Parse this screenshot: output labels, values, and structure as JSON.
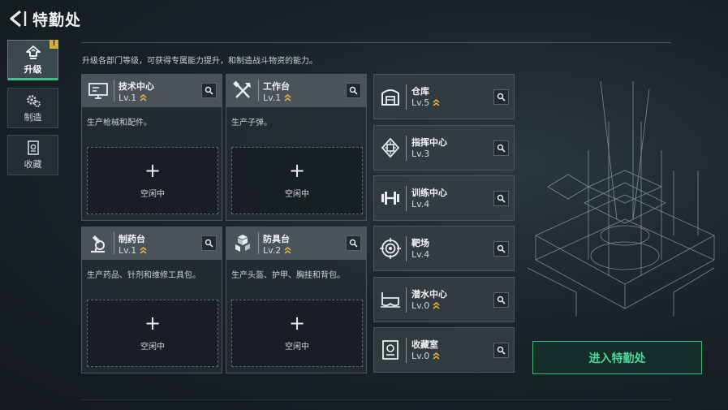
{
  "header": {
    "title": "特勤处"
  },
  "nav": [
    {
      "label": "升级",
      "icon": "upgrade-icon",
      "active": true,
      "badge": "!"
    },
    {
      "label": "制造",
      "icon": "gears-icon",
      "active": false
    },
    {
      "label": "收藏",
      "icon": "collection-icon",
      "active": false
    }
  ],
  "description": "升级各部门等级，可获得专属能力提升，和制造战斗物资的能力。",
  "cards": [
    {
      "name": "技术中心",
      "level": "Lv.1",
      "upgradable": true,
      "icon": "monitor-icon",
      "desc": "生产枪械和配件。",
      "slot_plus": "+",
      "slot_label": "空闲中"
    },
    {
      "name": "工作台",
      "level": "Lv.1",
      "upgradable": true,
      "icon": "tools-icon",
      "desc": "生产子弹。",
      "slot_plus": "+",
      "slot_label": "空闲中"
    },
    {
      "name": "制药台",
      "level": "Lv.1",
      "upgradable": true,
      "icon": "microscope-icon",
      "desc": "生产药品、针剂和维修工具包。",
      "slot_plus": "+",
      "slot_label": "空闲中"
    },
    {
      "name": "防具台",
      "level": "Lv.2",
      "upgradable": true,
      "icon": "armor-blocks-icon",
      "desc": "生产头盔、护甲、胸挂和背包。",
      "slot_plus": "+",
      "slot_label": "空闲中"
    }
  ],
  "facilities": [
    {
      "name": "仓库",
      "level": "Lv.5",
      "upgradable": true,
      "icon": "warehouse-icon"
    },
    {
      "name": "指挥中心",
      "level": "Lv.3",
      "upgradable": false,
      "icon": "chip-icon"
    },
    {
      "name": "训练中心",
      "level": "Lv.4",
      "upgradable": false,
      "icon": "dumbbell-icon"
    },
    {
      "name": "靶场",
      "level": "Lv.4",
      "upgradable": false,
      "icon": "target-icon"
    },
    {
      "name": "潜水中心",
      "level": "Lv.0",
      "upgradable": true,
      "icon": "diving-mask-icon"
    },
    {
      "name": "收藏室",
      "level": "Lv.0",
      "upgradable": true,
      "icon": "collection-room-icon"
    }
  ],
  "enter_button": "进入特勤处",
  "colors": {
    "accent_green": "#3fbf8a",
    "upgrade_chevron": "#e2b43a",
    "alert_badge": "#d8b12c"
  }
}
